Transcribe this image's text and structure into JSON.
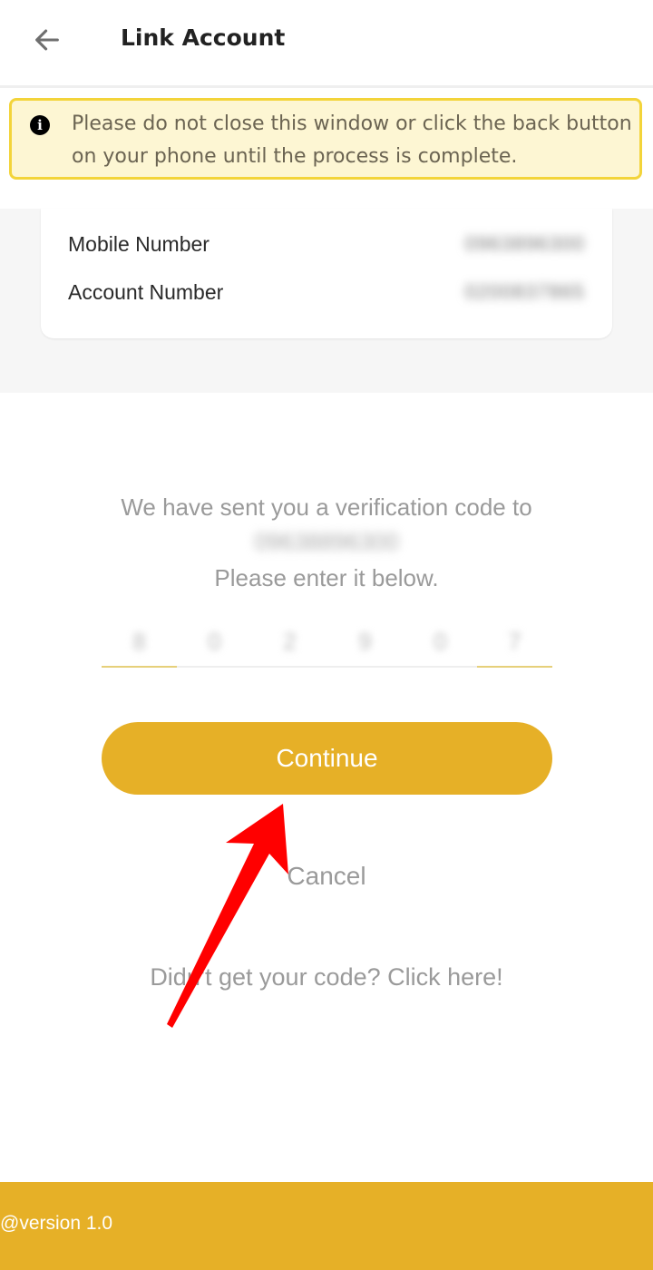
{
  "header": {
    "title": "Link Account",
    "back_icon": "arrow-left-icon"
  },
  "banner": {
    "icon": "info-icon",
    "icon_glyph": "i",
    "message": "Please do not close this window or click the back button on your phone until the process is complete."
  },
  "account_card": {
    "rows": [
      {
        "label": "Mobile Number",
        "value": "0963896300"
      },
      {
        "label": "Account Number",
        "value": "0200837865"
      }
    ]
  },
  "verification": {
    "line1": "We have sent you a verification code to",
    "phone": "09638896300",
    "line2": "Please enter it below.",
    "code_digits": [
      "8",
      "0",
      "2",
      "9",
      "0",
      "7"
    ]
  },
  "actions": {
    "continue_label": "Continue",
    "cancel_label": "Cancel",
    "resend_label": "Didn't get your code? Click here!"
  },
  "footer": {
    "version": "@version 1.0"
  },
  "colors": {
    "brand": "#e6b027",
    "banner_bg": "#fdf6d3",
    "banner_border": "#f3d43a",
    "annotation_arrow": "#ff0000"
  }
}
